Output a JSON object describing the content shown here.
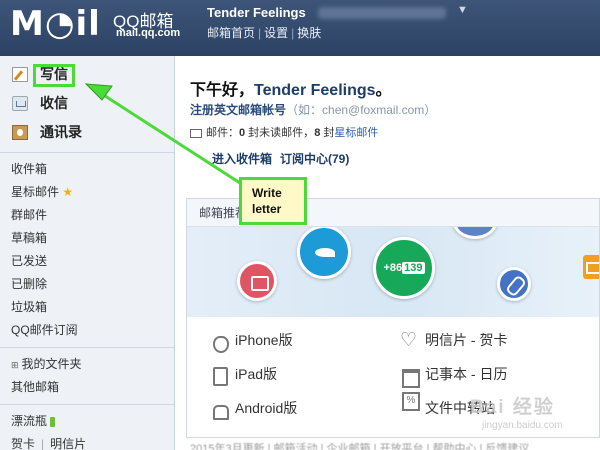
{
  "header": {
    "logo": "M◔il",
    "logo_title": "QQ邮箱",
    "logo_domain": "mail.qq.com",
    "user_name": "Tender Feelings",
    "caret": "▼",
    "links": [
      "邮箱首页",
      "设置",
      "换肤"
    ],
    "link_sep": "|"
  },
  "sidebar": {
    "write": "写信",
    "inbox": "收信",
    "contacts": "通讯录",
    "folders": [
      "收件箱",
      "星标邮件",
      "群邮件",
      "草稿箱",
      "已发送",
      "已删除",
      "垃圾箱",
      "QQ邮件订阅"
    ],
    "star_glyph": "★",
    "my_folders": "我的文件夹",
    "toggle": "⊞",
    "other_mailbox": "其他邮箱",
    "drift_bottle": "漂流瓶",
    "bottom_links": [
      "贺卡",
      "明信片"
    ],
    "bottom_sep": "|"
  },
  "main": {
    "greeting_prefix": "下午好，",
    "greeting_name": "Tender Feelings",
    "greeting_suffix": "。",
    "alias_label": "注册英文邮箱帐号",
    "alias_example": "（如：chen@foxmail.com）",
    "stats_prefix": "邮件：",
    "unread_count": "0",
    "unread_label": " 封未读邮件，",
    "starred_count": "8",
    "starred_label_pre": " 封",
    "starred_link": "星标邮件",
    "quick_links": [
      "进入收件箱",
      "订阅中心(79)"
    ],
    "recommend_title": "邮箱推荐",
    "phone_num1": "+86",
    "phone_num2": "139",
    "apps_left": [
      "iPhone版",
      "iPad版",
      "Android版"
    ],
    "apps_right": [
      "明信片 - 贺卡",
      "记事本 - 日历",
      "文件中转站"
    ],
    "footer_text": "2015年3月更新 | 邮箱活动 | 企业邮箱 | 开放平台 | 帮助中心 | 反馈建议"
  },
  "overlay": {
    "callout_line1": "Write",
    "callout_line2": "letter",
    "watermark": "Bai 经验",
    "watermark_sub": "jingyan.baidu.com",
    "highlight_color": "#4cd93a"
  }
}
